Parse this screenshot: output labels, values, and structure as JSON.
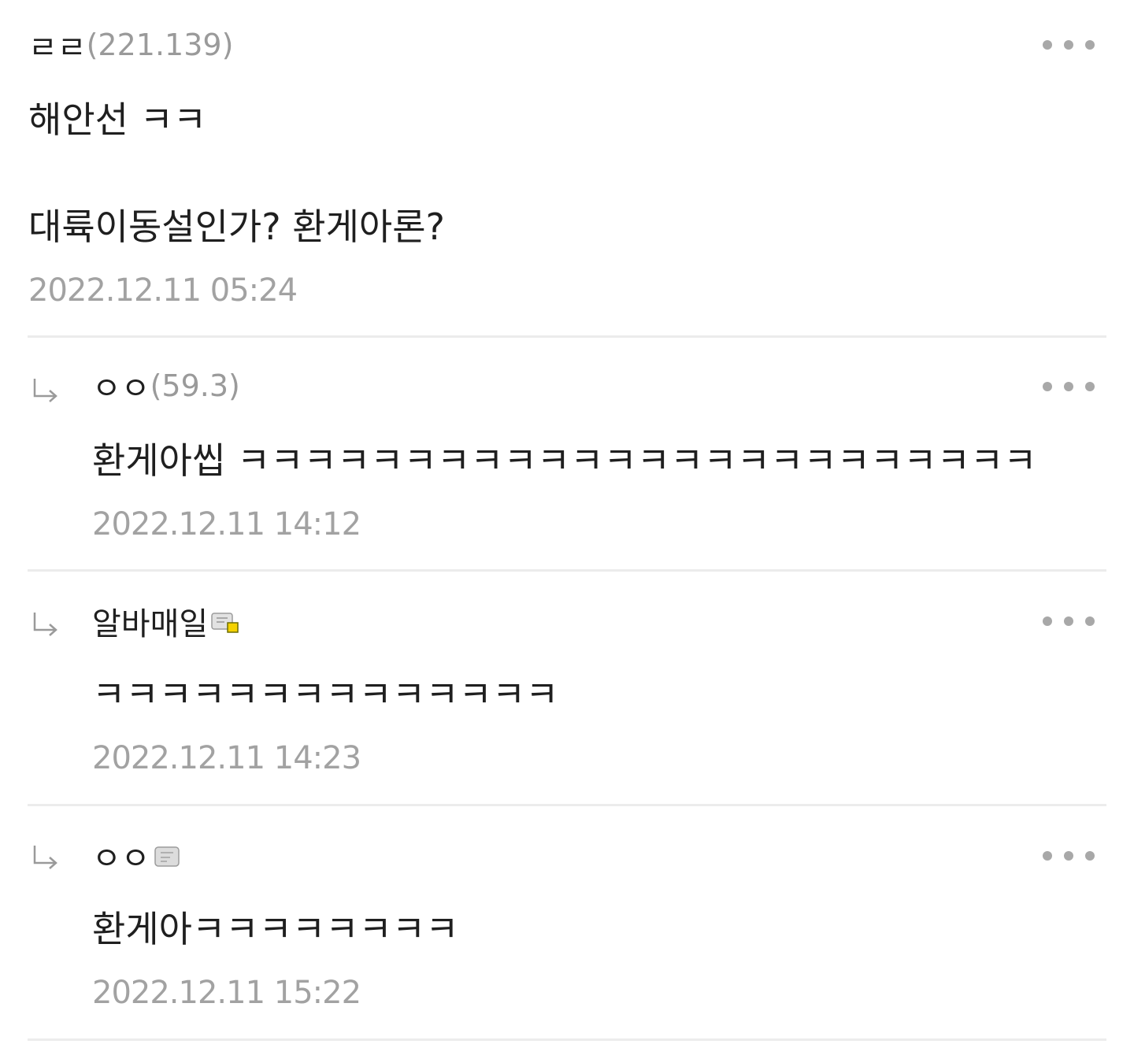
{
  "comments": [
    {
      "nick": "ㄹㄹ",
      "ip": "(221.139)",
      "lines": [
        "해안선 ㅋㅋ",
        "대륙이동설인가? 환게아론?"
      ],
      "date": "2022.12.11 05:24"
    },
    {
      "reply_arrow": "↳",
      "nick": "ㅇㅇ",
      "ip": "(59.3)",
      "text": "환게아씹 ㅋㅋㅋㅋㅋㅋㅋㅋㅋㅋㅋㅋㅋㅋㅋㅋㅋㅋㅋㅋㅋㅋㅋㅋ",
      "date": "2022.12.11 14:12"
    },
    {
      "reply_arrow": "↳",
      "nick": "알바매일",
      "badge_icon": "fixed-nick-member-icon",
      "text": "ㅋㅋㅋㅋㅋㅋㅋㅋㅋㅋㅋㅋㅋㅋ",
      "date": "2022.12.11 14:23"
    },
    {
      "reply_arrow": "↳",
      "nick": "ㅇㅇ",
      "badge_icon": "half-nick-member-icon",
      "text": "환게아ㅋㅋㅋㅋㅋㅋㅋㅋ",
      "date": "2022.12.11 15:22"
    }
  ],
  "more_icon": "more-options-icon",
  "colors": {
    "text": "#1f1f1f",
    "meta": "#a2a2a2",
    "divider": "#ececec",
    "badge_accent": "#f5d200"
  }
}
